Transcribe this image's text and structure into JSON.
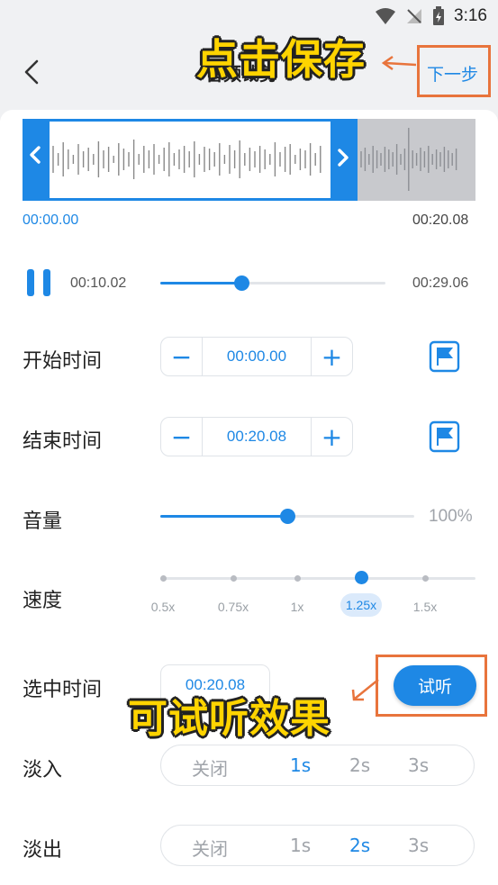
{
  "status": {
    "time": "3:16"
  },
  "header": {
    "title": "音频裁剪",
    "next_label": "下一步"
  },
  "waveform": {
    "start_time": "00:00.00",
    "end_time": "00:20.08"
  },
  "player": {
    "current": "00:10.02",
    "duration": "00:29.06",
    "progress": 0.36
  },
  "start_row": {
    "label": "开始时间",
    "value": "00:00.00",
    "minus": "−",
    "plus": "+"
  },
  "end_row": {
    "label": "结束时间",
    "value": "00:20.08",
    "minus": "−",
    "plus": "+"
  },
  "volume": {
    "label": "音量",
    "percent_text": "100%",
    "level": 0.5
  },
  "speed": {
    "label": "速度",
    "options": [
      "0.5x",
      "0.75x",
      "1x",
      "1.25x",
      "1.5x"
    ],
    "selected": "1.25x"
  },
  "selected_time": {
    "label": "选中时间",
    "value": "00:20.08",
    "preview_button": "试听"
  },
  "fade_in": {
    "label": "淡入",
    "options": [
      "关闭",
      "1s",
      "2s",
      "3s"
    ],
    "selected": "1s"
  },
  "fade_out": {
    "label": "淡出",
    "options": [
      "关闭",
      "1s",
      "2s",
      "3s"
    ],
    "selected": "2s"
  },
  "annotations": {
    "save_hint": "点击保存",
    "listen_hint": "可试听效果"
  },
  "colors": {
    "accent": "#1e88e5",
    "annotation_text": "#ffd400",
    "annotation_box": "#e8743c"
  }
}
